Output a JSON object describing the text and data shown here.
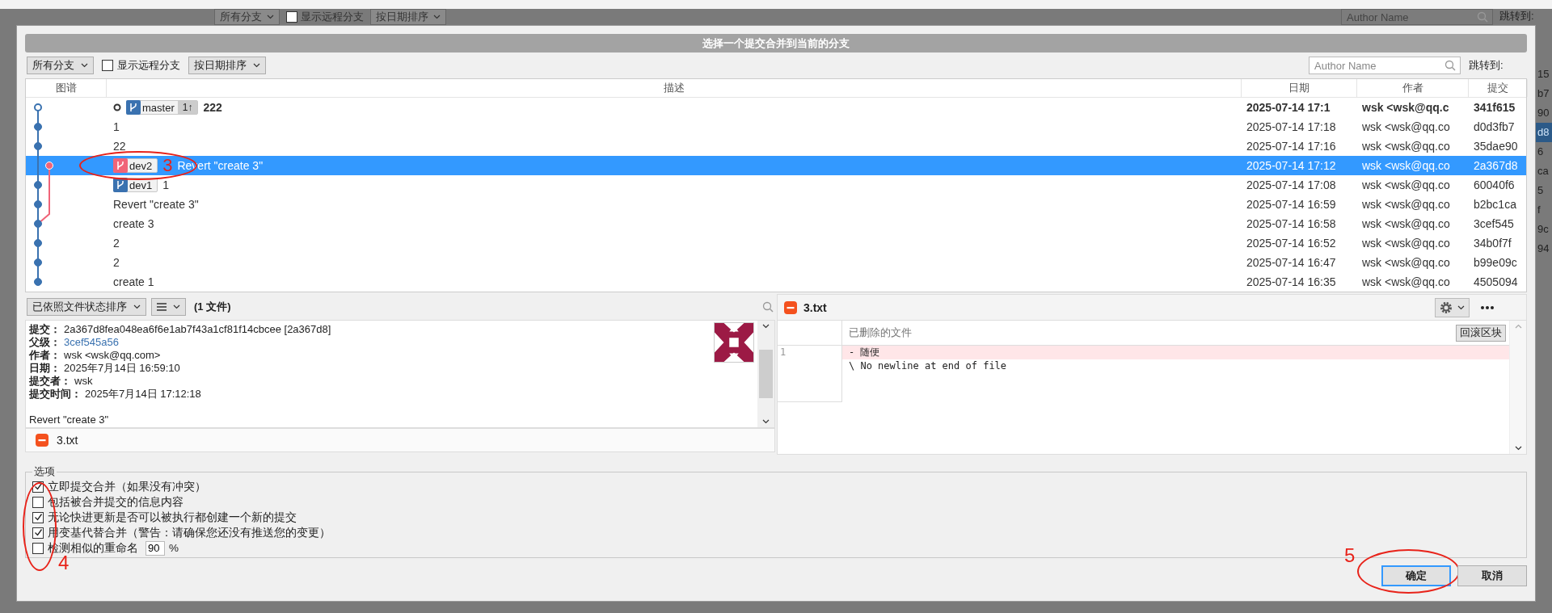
{
  "background": {
    "toolbar": {
      "branch_filter": "所有分支",
      "show_remote": {
        "label": "显示远程分支",
        "checked": false
      },
      "sort": "按日期排序",
      "author_search": {
        "placeholder": "Author Name"
      },
      "jump_to": "跳转到:"
    },
    "hash_fragments": [
      {
        "text": "15",
        "selected": false
      },
      {
        "text": "b7",
        "selected": false
      },
      {
        "text": "90",
        "selected": false
      },
      {
        "text": "d8",
        "selected": true
      },
      {
        "text": "6",
        "selected": false
      },
      {
        "text": "ca",
        "selected": false
      },
      {
        "text": "5",
        "selected": false
      },
      {
        "text": "f",
        "selected": false
      },
      {
        "text": "9c",
        "selected": false
      },
      {
        "text": "94",
        "selected": false
      }
    ]
  },
  "dialog": {
    "title": "选择一个提交合并到当前的分支",
    "toolbar": {
      "branch_filter": "所有分支",
      "show_remote": {
        "label": "显示远程分支",
        "checked": false
      },
      "sort": "按日期排序",
      "author_search": {
        "placeholder": "Author Name"
      },
      "jump_to": "跳转到:"
    },
    "commit_table": {
      "columns": [
        "图谱",
        "描述",
        "日期",
        "作者",
        "提交"
      ],
      "rows": [
        {
          "head": true,
          "selected": false,
          "color": "#3a72b0",
          "refs": [
            {
              "name": "master",
              "color": "#3a72b0",
              "ahead": "1↑"
            }
          ],
          "description": "222",
          "date": "2025-07-14 17:1",
          "author": "wsk <wsk@qq.c",
          "hash": "341f615"
        },
        {
          "head": false,
          "selected": false,
          "color": "#3a72b0",
          "description": "1",
          "date": "2025-07-14 17:18",
          "author": "wsk <wsk@qq.co",
          "hash": "d0d3fb7"
        },
        {
          "head": false,
          "selected": false,
          "color": "#3a72b0",
          "description": "22",
          "date": "2025-07-14 17:16",
          "author": "wsk <wsk@qq.co",
          "hash": "35dae90"
        },
        {
          "head": false,
          "selected": true,
          "color": "#f06478",
          "refs": [
            {
              "name": "dev2",
              "color": "#f06478"
            }
          ],
          "annotation": {
            "label": "3"
          },
          "description": "Revert \"create 3\"",
          "date": "2025-07-14 17:12",
          "author": "wsk <wsk@qq.co",
          "hash": "2a367d8"
        },
        {
          "head": false,
          "selected": false,
          "color": "#3a72b0",
          "refs": [
            {
              "name": "dev1",
              "color": "#3a72b0"
            }
          ],
          "description": "1",
          "date": "2025-07-14 17:08",
          "author": "wsk <wsk@qq.co",
          "hash": "60040f6"
        },
        {
          "head": false,
          "selected": false,
          "color": "#3a72b0",
          "description": "Revert \"create 3\"",
          "date": "2025-07-14 16:59",
          "author": "wsk <wsk@qq.co",
          "hash": "b2bc1ca"
        },
        {
          "head": false,
          "selected": false,
          "color": "#3a72b0",
          "description": "create 3",
          "date": "2025-07-14 16:58",
          "author": "wsk <wsk@qq.co",
          "hash": "3cef545"
        },
        {
          "head": false,
          "selected": false,
          "color": "#3a72b0",
          "description": "2",
          "date": "2025-07-14 16:52",
          "author": "wsk <wsk@qq.co",
          "hash": "34b0f7f"
        },
        {
          "head": false,
          "selected": false,
          "color": "#3a72b0",
          "description": "2",
          "date": "2025-07-14 16:47",
          "author": "wsk <wsk@qq.co",
          "hash": "b99e09c"
        },
        {
          "head": false,
          "selected": false,
          "color": "#3a72b0",
          "description": "create 1",
          "date": "2025-07-14 16:35",
          "author": "wsk <wsk@qq.co",
          "hash": "4505094"
        }
      ]
    },
    "file_toolbar": {
      "sort": "已依照文件状态排序",
      "file_count": "(1 文件)"
    },
    "details": {
      "lines": [
        {
          "kind": "text",
          "label": "提交：",
          "value": "2a367d8fea048ea6f6e1ab7f43a1cf81f14cbcee [2a367d8]"
        },
        {
          "kind": "link",
          "label": "父级：",
          "value": "3cef545a56"
        },
        {
          "kind": "text",
          "label": "作者：",
          "value": "wsk <wsk@qq.com>"
        },
        {
          "kind": "text",
          "label": "日期：",
          "value": "2025年7月14日 16:59:10"
        },
        {
          "kind": "text",
          "label": "提交者：",
          "value": "wsk"
        },
        {
          "kind": "text",
          "label": "提交时间：",
          "value": "2025年7月14日 17:12:18"
        }
      ],
      "message": "Revert \"create 3\""
    },
    "files": [
      {
        "name": "3.txt",
        "kind": "deleted"
      }
    ],
    "diff": {
      "file": {
        "name": "3.txt",
        "kind": "deleted"
      },
      "hunk_header": "已删除的文件",
      "revert_button": "回滚区块",
      "lines": [
        {
          "kind": "removed",
          "number": "1",
          "text": "- 随便"
        },
        {
          "kind": "meta",
          "text": "\\ No newline at end of file"
        }
      ]
    },
    "options": {
      "title": "选项",
      "annotation": {
        "label": "4"
      },
      "items": [
        {
          "label": "立即提交合并（如果没有冲突）",
          "checked": true
        },
        {
          "label": "包括被合并提交的信息内容",
          "checked": false
        },
        {
          "label": "无论快进更新是否可以被执行都创建一个新的提交",
          "checked": true
        },
        {
          "label": "用变基代替合并（警告：请确保您还没有推送您的变更）",
          "checked": true
        },
        {
          "label": "检测相似的重命名",
          "checked": false,
          "value": "90",
          "unit": "%"
        }
      ]
    },
    "buttons": [
      {
        "label": "确定",
        "default": true,
        "annotation": {
          "label": "5"
        }
      },
      {
        "label": "取消",
        "default": false
      }
    ]
  }
}
